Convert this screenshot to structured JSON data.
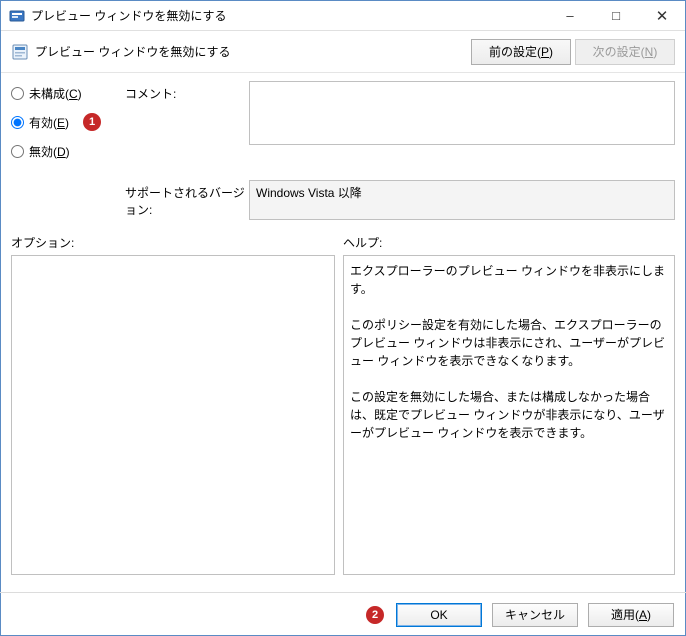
{
  "window": {
    "title": "プレビュー ウィンドウを無効にする",
    "sub_title": "プレビュー ウィンドウを無効にする"
  },
  "nav": {
    "prev_label_pre": "前の設定(",
    "prev_label_key": "P",
    "prev_label_post": ")",
    "next_label_pre": "次の設定(",
    "next_label_key": "N",
    "next_label_post": ")"
  },
  "radios": {
    "not_configured_pre": "未構成(",
    "not_configured_key": "C",
    "not_configured_post": ")",
    "enabled_pre": "有効(",
    "enabled_key": "E",
    "enabled_post": ")",
    "disabled_pre": "無効(",
    "disabled_key": "D",
    "disabled_post": ")",
    "selected": "enabled"
  },
  "labels": {
    "comment": "コメント:",
    "supported": "サポートされるバージョン:",
    "options": "オプション:",
    "help": "ヘルプ:"
  },
  "fields": {
    "comment_value": "",
    "supported_value": "Windows Vista 以降"
  },
  "help": {
    "p1": "エクスプローラーのプレビュー ウィンドウを非表示にします。",
    "p2": "このポリシー設定を有効にした場合、エクスプローラーのプレビュー ウィンドウは非表示にされ、ユーザーがプレビュー ウィンドウを表示できなくなります。",
    "p3": "この設定を無効にした場合、または構成しなかった場合は、既定でプレビュー ウィンドウが非表示になり、ユーザーがプレビュー ウィンドウを表示できます。"
  },
  "buttons": {
    "ok": "OK",
    "cancel": "キャンセル",
    "apply_pre": "適用(",
    "apply_key": "A",
    "apply_post": ")"
  },
  "annotations": {
    "a1": "1",
    "a2": "2"
  }
}
